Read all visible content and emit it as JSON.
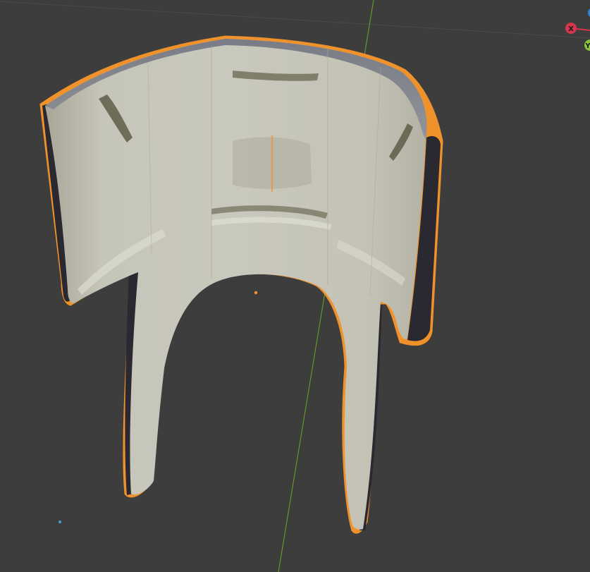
{
  "viewport": {
    "background_color": "#3d3d3d",
    "grid_line_color": "#4a4a4a",
    "selection_outline_color": "#f0922c",
    "mesh_color": "#bdbcb0"
  },
  "navigation_gizmo": {
    "x_label": "X",
    "y_label": "Y",
    "x_color": "#d4364d",
    "y_color": "#8ac33a",
    "z_color": "#2f83d8"
  },
  "scene_axes": {
    "y_axis_color": "#6aa528"
  },
  "selected_object": {
    "shape": "curved-bracket-mesh",
    "origin_dot_color": "#f0922c"
  },
  "light_icon_color": "#4a9bd6"
}
